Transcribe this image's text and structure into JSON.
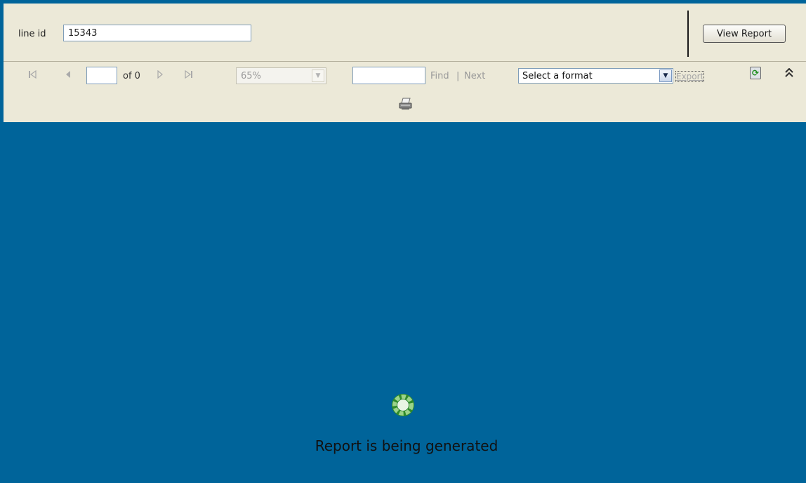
{
  "parameters": {
    "line_id_label": "line id",
    "line_id_value": "15343",
    "view_report_label": "View Report"
  },
  "toolbar": {
    "first_page_icon": "first-page-icon",
    "prev_page_icon": "previous-page-icon",
    "page_value": "",
    "page_of_label": "of 0",
    "next_page_icon": "next-page-icon",
    "last_page_icon": "last-page-icon",
    "zoom_value": "65%",
    "find_value": "",
    "find_label": "Find",
    "find_separator": "|",
    "next_label": "Next",
    "format_value": "Select a format",
    "export_label": "Export",
    "refresh_icon": "refresh-icon",
    "collapse_icon": "collapse-toolbar-icon",
    "print_icon": "print-icon"
  },
  "status": {
    "loading_text": "Report is being generated"
  },
  "colors": {
    "background": "#00649a",
    "panel": "#ece9d8",
    "disabled_text": "#999999",
    "spinner_green": "#3a9a2e"
  }
}
